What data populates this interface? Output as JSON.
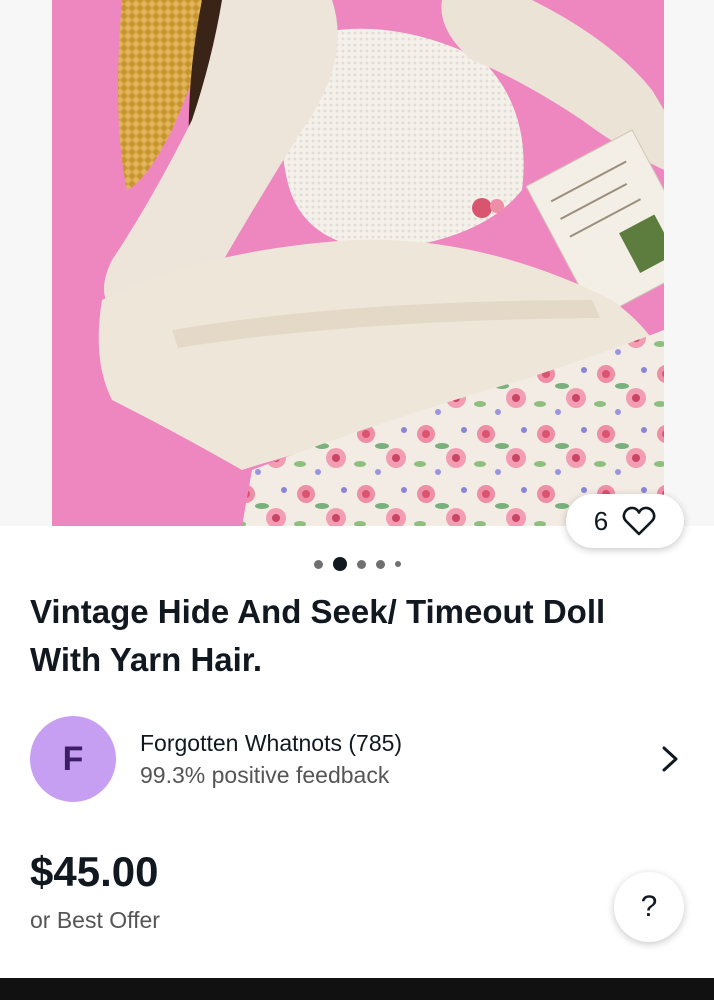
{
  "gallery": {
    "image_alt": "Doll with white knit top and pink floral skirt on pink background",
    "dot_count": 5,
    "active_dot": 1
  },
  "watch": {
    "count": "6",
    "icon": "heart-outline-icon"
  },
  "listing": {
    "title": "Vintage Hide And Seek/ Timeout Doll With Yarn Hair."
  },
  "seller": {
    "initial": "F",
    "name": "Forgotten Whatnots (785)",
    "feedback": "99.3% positive feedback",
    "avatar_color": "#c79ff2"
  },
  "pricing": {
    "price": "$45.00",
    "offer_text": "or Best Offer"
  },
  "help": {
    "label": "?"
  },
  "colors": {
    "photo_background": "#ee86c0",
    "text": "#111820",
    "secondary_text": "#555555"
  }
}
